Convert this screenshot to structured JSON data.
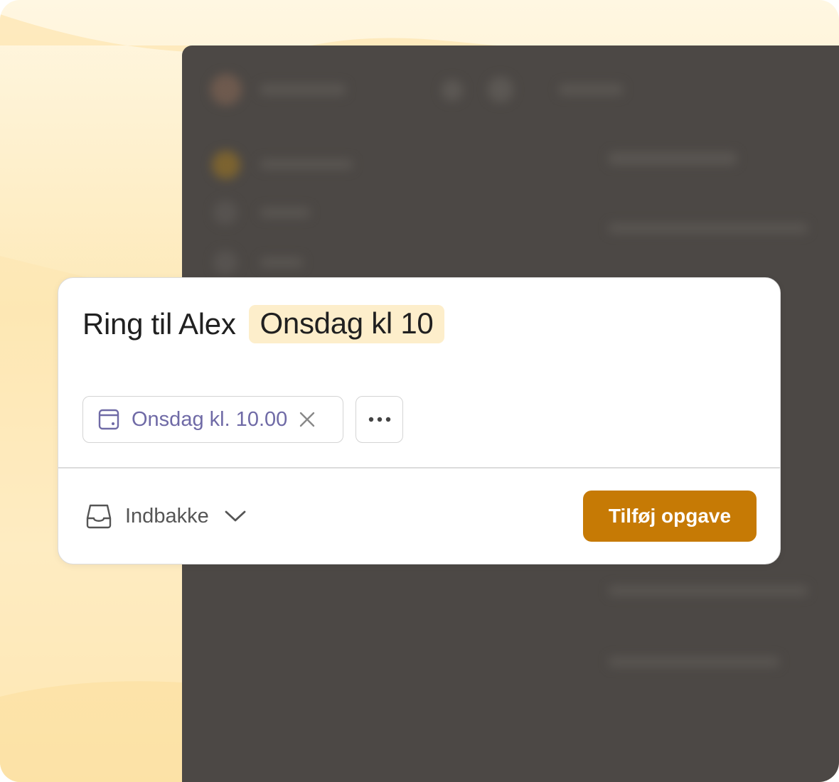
{
  "task_input": {
    "title": "Ring til Alex",
    "date_token": "Onsdag kl 10"
  },
  "chips": {
    "date": {
      "icon": "calendar-icon",
      "label": "Onsdag kl. 10.00",
      "clear_icon": "close-icon"
    },
    "more": {
      "icon": "more-horizontal-icon"
    }
  },
  "project": {
    "icon": "inbox-icon",
    "label": "Indbakke",
    "dropdown_icon": "chevron-down-icon"
  },
  "actions": {
    "add_label": "Tilføj opgave"
  },
  "colors": {
    "accent": "#c67a05",
    "date_text": "#6f6aa6",
    "date_highlight": "#fdeecb",
    "background_dim": "#4c4845"
  }
}
